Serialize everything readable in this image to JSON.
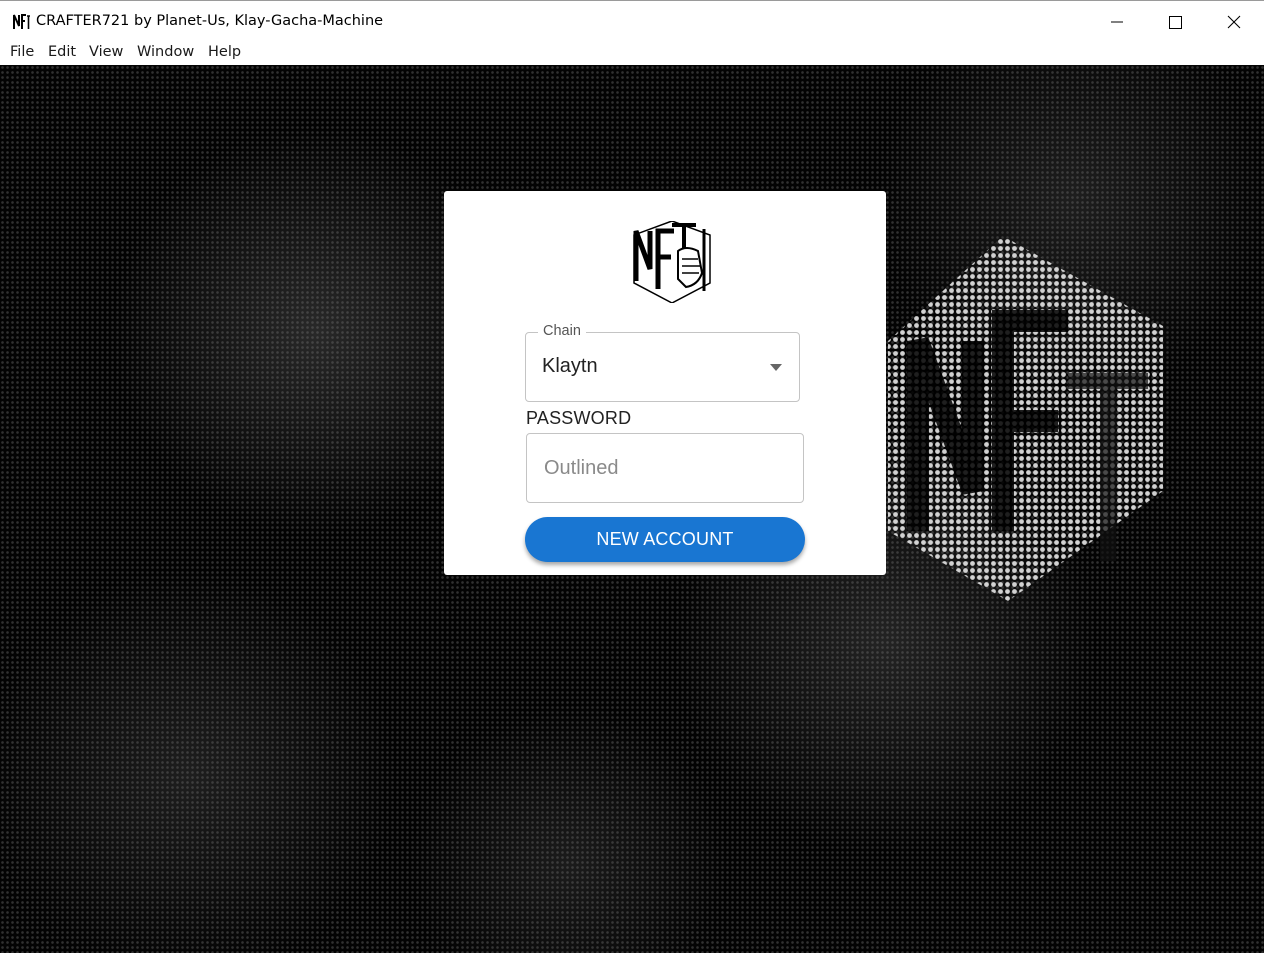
{
  "window": {
    "title": "CRAFTER721 by Planet-Us, Klay-Gacha-Machine",
    "app_icon": "nft-logo-icon",
    "controls": [
      "minimize-icon",
      "maximize-icon",
      "close-icon"
    ]
  },
  "menu": {
    "items": [
      "File",
      "Edit",
      "View",
      "Window",
      "Help"
    ]
  },
  "login": {
    "logo_icon": "nft-hammer-hand-logo",
    "chain": {
      "label": "Chain",
      "value": "Klaytn"
    },
    "password": {
      "label": "PASSWORD",
      "placeholder": "Outlined"
    },
    "new_account_label": "NEW ACCOUNT"
  },
  "colors": {
    "primary_button": "#1976d2",
    "background": "#030303",
    "card": "#ffffff"
  }
}
